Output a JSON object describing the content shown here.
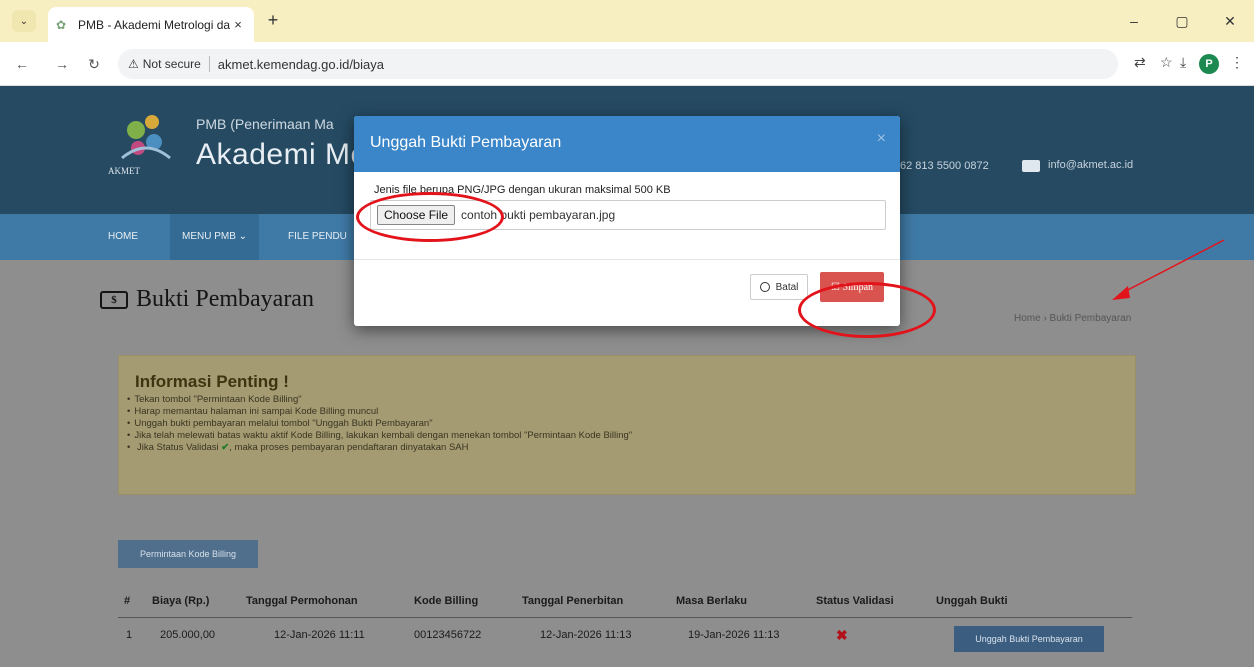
{
  "browser": {
    "tab_title": "PMB - Akademi Metrologi dan",
    "new_tab_symbol": "+",
    "tab_close_symbol": "×",
    "dropdown_symbol": "⌄",
    "security_label": "Not secure",
    "url": "akmet.kemendag.go.id/biaya",
    "profile_initial": "P",
    "window_controls": [
      "–",
      "▢",
      "✕"
    ]
  },
  "header": {
    "logo_text": "AKMET",
    "subtitle": "PMB (Penerimaan Ma",
    "title": "Akademi Met",
    "phone": "62 813 5500 0872",
    "email": "info@akmet.ac.id"
  },
  "nav": {
    "items": [
      "HOME",
      "MENU PMB ⌄",
      "FILE PENDU"
    ]
  },
  "page": {
    "title": "Bukti Pembayaran",
    "money_symbol": "$",
    "breadcrumb": "Home › Bukti Pembayaran"
  },
  "info": {
    "title": "Informasi Penting !",
    "items": [
      "Tekan tombol \"Permintaan Kode Billing\"",
      "Harap memantau halaman ini sampai Kode Billing muncul",
      "Unggah bukti pembayaran melalui tombol \"Unggah Bukti Pembayaran\"",
      "Jika telah melewati batas waktu aktif Kode Billing, lakukan kembali dengan menekan tombol \"Permintaan Kode Billing\""
    ],
    "last_item_before": "Jika Status Validasi",
    "last_item_check": "✔",
    "last_item_after": ", maka proses pembayaran pendaftaran dinyatakan SAH"
  },
  "billing_button": "Permintaan Kode Billing",
  "table": {
    "headers": [
      "#",
      "Biaya (Rp.)",
      "Tanggal Permohonan",
      "Kode Billing",
      "Tanggal Penerbitan",
      "Masa Berlaku",
      "Status Validasi",
      "Unggah Bukti"
    ],
    "rows": [
      {
        "no": "1",
        "biaya": "205.000,00",
        "tgl_permohonan": "12-Jan-2026 11:11",
        "kode_billing": "00123456722",
        "tgl_penerbitan": "12-Jan-2026 11:13",
        "masa_berlaku": "19-Jan-2026 11:13",
        "status": "✖",
        "upload_label": "Unggah Bukti Pembayaran"
      }
    ]
  },
  "modal": {
    "title": "Unggah Bukti Pembayaran",
    "close": "×",
    "hint": "Jenis file berupa PNG/JPG dengan ukuran maksimal 500 KB",
    "choose_label": "Choose File",
    "file_name": "contoh bukti pembayaran.jpg",
    "cancel_label": "Batal",
    "save_label": "☑ Simpan"
  },
  "colors": {
    "header_bg": "#254a62",
    "navbar_bg": "#3f7aa6",
    "modal_header": "#3a86c8",
    "save_button": "#d9534f",
    "annotation_red": "#e3131b"
  }
}
